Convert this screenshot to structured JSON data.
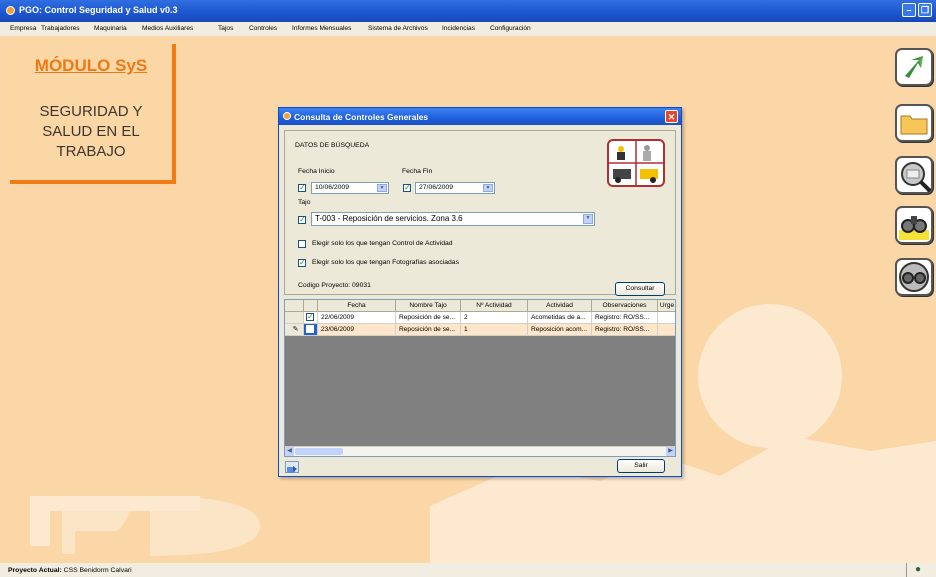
{
  "window": {
    "title": "PGO: Control Seguridad y Salud v0.3"
  },
  "menu": [
    "Empresa",
    "Trabajadores",
    "Maquinaria",
    "Medios Auxiliares",
    "Tajos",
    "Controles",
    "Informes Mensuales",
    "Sistema de Archivos",
    "Incidencias",
    "Configuración"
  ],
  "module": {
    "title": "MÓDULO SyS",
    "line1": "SEGURIDAD Y",
    "line2": "SALUD EN EL",
    "line3": "TRABAJO"
  },
  "side_buttons": [
    "arrow-icon",
    "folder-icon",
    "magnifier-icon",
    "binoculars-icon",
    "binoculars-gray-icon"
  ],
  "dialog": {
    "title": "Consulta de Controles Generales",
    "section_title": "DATOS DE BÚSQUEDA",
    "fecha_inicio_label": "Fecha Inicio",
    "fecha_inicio": "10/06/2009",
    "fecha_fin_label": "Fecha Fin",
    "fecha_fin": "27/06/2009",
    "tajo_label": "Tajo",
    "tajo": "T-003 - Reposición de servicios. Zona 3.6",
    "opt_control": "Elegir solo los que tengan Control de Actividad",
    "opt_fotos": "Elegir solo los que tengan Fotografías asociadas",
    "codigo_proyecto": "Codigo Proyecto: 09031",
    "consultar": "Consultar",
    "salir": "Salir",
    "columns": [
      "Fecha",
      "Nombre Tajo",
      "Nº Actividad",
      "Actividad",
      "Observaciones",
      "Urge"
    ],
    "rows": [
      [
        "22/06/2009",
        "Reposición de se...",
        "2",
        "Acometidas de a...",
        "Registro: RO/SS..."
      ],
      [
        "23/06/2009",
        "Reposición de se...",
        "1",
        "Reposición acom...",
        "Registro: RO/SS..."
      ]
    ]
  },
  "status": {
    "label": "Proyecto Actual:",
    "value": "CSS Benidorm Calvari"
  },
  "colors": {
    "accent": "#f07d14",
    "background": "#fbd6a6",
    "titlebar": "#1d56cf"
  }
}
